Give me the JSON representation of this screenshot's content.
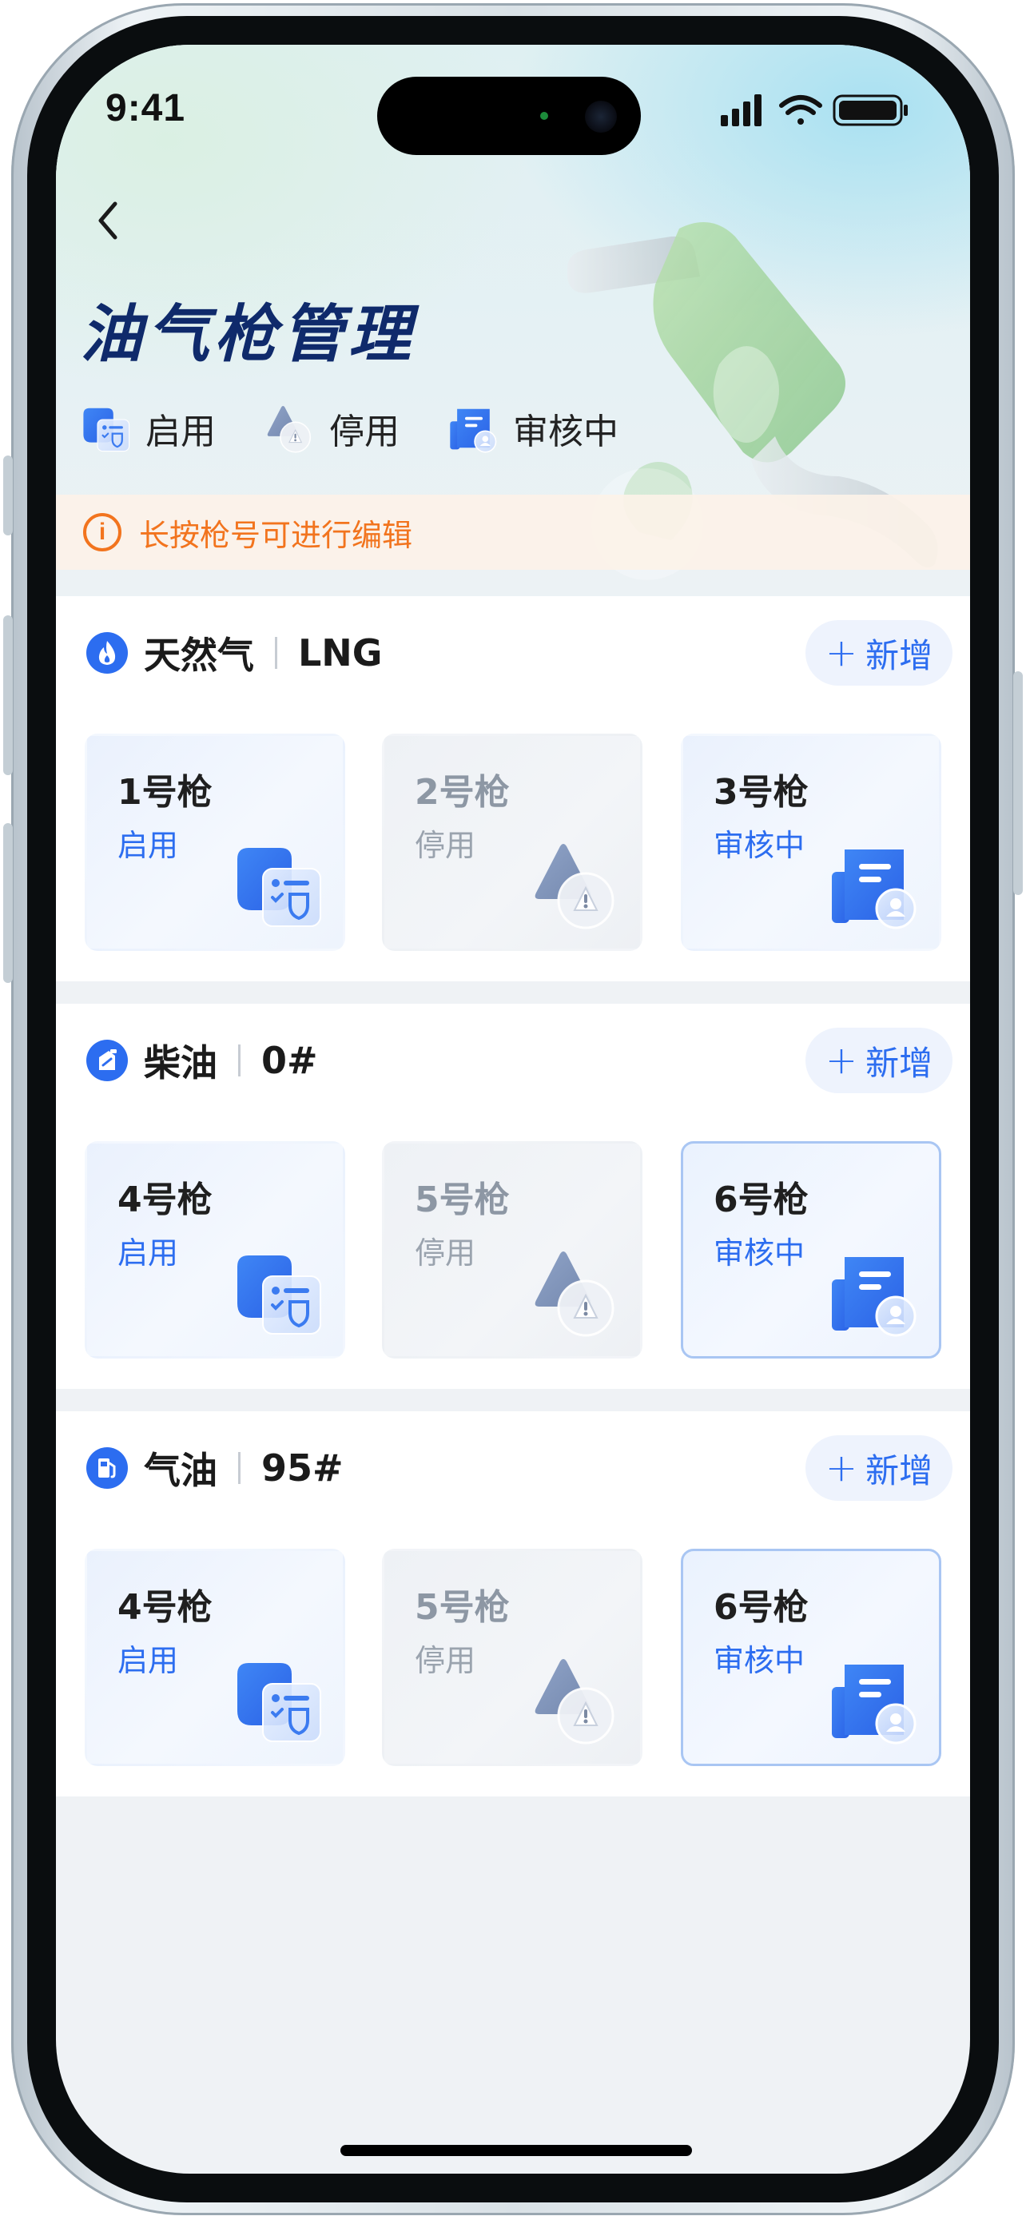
{
  "status_bar": {
    "time": "9:41"
  },
  "header": {
    "title": "油气枪管理",
    "legend": [
      {
        "icon": "enabled-status-icon",
        "label": "启用"
      },
      {
        "icon": "disabled-status-icon",
        "label": "停用"
      },
      {
        "icon": "review-status-icon",
        "label": "审核中"
      }
    ]
  },
  "notice": {
    "icon": "info-icon",
    "text": "长按枪号可进行编辑"
  },
  "sections": [
    {
      "icon": "flame-icon",
      "name": "天然气",
      "code": "LNG",
      "add_label": "新增",
      "guns": [
        {
          "name": "1号枪",
          "status": "启用"
        },
        {
          "name": "2号枪",
          "status": "停用"
        },
        {
          "name": "3号枪",
          "status": "审核中"
        }
      ]
    },
    {
      "icon": "oil-can-icon",
      "name": "柴油",
      "code": "0#",
      "add_label": "新增",
      "guns": [
        {
          "name": "4号枪",
          "status": "启用"
        },
        {
          "name": "5号枪",
          "status": "停用"
        },
        {
          "name": "6号枪",
          "status": "审核中"
        }
      ]
    },
    {
      "icon": "fuel-pump-icon",
      "name": "气油",
      "code": "95#",
      "add_label": "新增",
      "guns": [
        {
          "name": "4号枪",
          "status": "启用"
        },
        {
          "name": "5号枪",
          "status": "停用"
        },
        {
          "name": "6号枪",
          "status": "审核中"
        }
      ]
    }
  ],
  "colors": {
    "accent": "#2c6df0",
    "title": "#0f2a6b",
    "warning": "#f2741e",
    "disabled_text": "#9aa3ae"
  }
}
